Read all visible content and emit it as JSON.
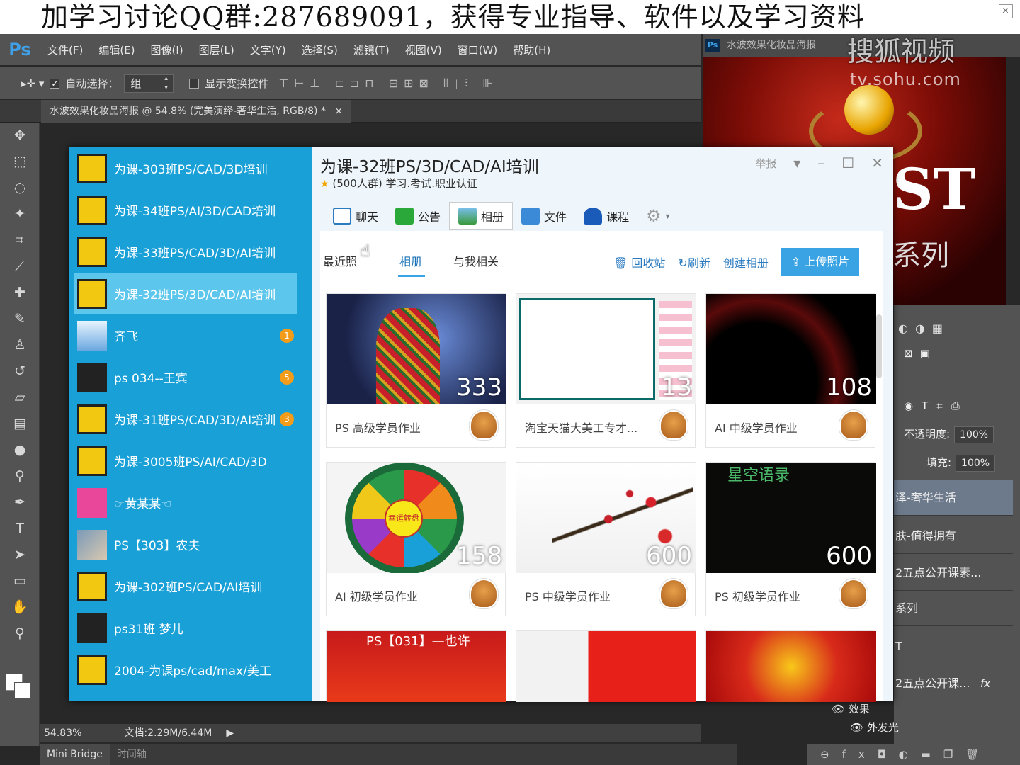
{
  "banner": {
    "text": "加学习讨论QQ群:287689091，获得专业指导、软件以及学习资料"
  },
  "watermark": {
    "brand": "搜狐视频",
    "url": "tv.sohu.com"
  },
  "ps": {
    "logo": "Ps",
    "menu": [
      "文件(F)",
      "编辑(E)",
      "图像(I)",
      "图层(L)",
      "文字(Y)",
      "选择(S)",
      "滤镜(T)",
      "视图(V)",
      "窗口(W)",
      "帮助(H)"
    ],
    "options": {
      "auto_select_label": "自动选择：",
      "auto_select_value": "组",
      "show_transform_label": "显示变换控件"
    },
    "doc_tab": "水波效果化妆品海报 @ 54.8% (完美演绎-奢华生活, RGB/8) *",
    "doc_tab_close": "×",
    "second_tab": "水波效果化妆品海报",
    "status": {
      "zoom": "54.83%",
      "doc": "文档:2.29M/6.44M"
    },
    "bottom_tabs": [
      "Mini Bridge",
      "时间轴"
    ],
    "poster": {
      "title": "ST",
      "subtitle": "系列"
    },
    "right_panel": {
      "opacity_label": "不透明度:",
      "opacity_value": "100%",
      "fill_label": "填充:",
      "fill_value": "100%",
      "layers": [
        "泽-奢华生活",
        "肤-值得拥有",
        "2五点公开课素...",
        "系列",
        "T",
        "2五点公开课..."
      ],
      "fx_label": "fx",
      "effects_label": "效果",
      "outer_glow_label": "外发光"
    }
  },
  "qq": {
    "groups": [
      {
        "name": "为课-303班PS/CAD/3D培训",
        "avatar": "logo",
        "badge": ""
      },
      {
        "name": "为课-34班PS/AI/3D/CAD培训",
        "avatar": "logo",
        "badge": ""
      },
      {
        "name": "为课-33班PS/CAD/3D/AI培训",
        "avatar": "logo",
        "badge": ""
      },
      {
        "name": "为课-32班PS/3D/CAD/AI培训",
        "avatar": "logo",
        "badge": "",
        "active": true
      },
      {
        "name": "齐飞",
        "avatar": "sky",
        "badge": "1"
      },
      {
        "name": "ps 034--王宾",
        "avatar": "dark",
        "badge": "5"
      },
      {
        "name": "为课-31班PS/CAD/3D/AI培训",
        "avatar": "logo",
        "badge": "3"
      },
      {
        "name": "为课-3005班PS/AI/CAD/3D",
        "avatar": "logo",
        "badge": ""
      },
      {
        "name": "☞黄某某☜",
        "avatar": "pink",
        "badge": ""
      },
      {
        "name": "PS【303】农夫",
        "avatar": "photo",
        "badge": ""
      },
      {
        "name": "为课-302班PS/CAD/AI培训",
        "avatar": "logo",
        "badge": ""
      },
      {
        "name": "ps31班 梦儿",
        "avatar": "dark",
        "badge": ""
      },
      {
        "name": "2004-为课ps/cad/max/美工",
        "avatar": "logo",
        "badge": ""
      }
    ],
    "title": "为课-32班PS/3D/CAD/AI培训",
    "subtitle": "(500人群) 学习.考试.职业认证",
    "report_label": "举报",
    "tabs": [
      "聊天",
      "公告",
      "相册",
      "文件",
      "课程"
    ],
    "subtabs": [
      "最近照",
      "相册",
      "与我相关"
    ],
    "actions": {
      "recycle": "回收站",
      "refresh": "刷新",
      "create": "创建相册",
      "upload": "上传照片"
    },
    "albums": [
      {
        "name": "PS 高级学员作业",
        "count": "333"
      },
      {
        "name": "淘宝天猫大美工专才...",
        "count": "13"
      },
      {
        "name": "AI 中级学员作业",
        "count": "108"
      },
      {
        "name": "AI 初级学员作业",
        "count": "158"
      },
      {
        "name": "PS 中级学员作业",
        "count": "600"
      },
      {
        "name": "PS 初级学员作业",
        "count": "600"
      }
    ],
    "wheel_text": "幸运转盘",
    "poem_title": "星空语录",
    "bottom_album_text": "PS【031】—也许"
  }
}
